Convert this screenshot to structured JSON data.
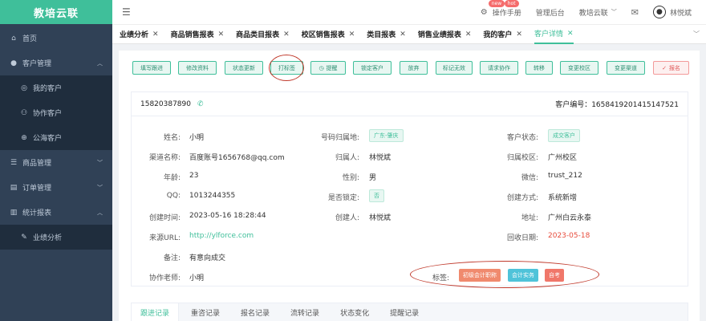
{
  "app": {
    "logo": "教培云联"
  },
  "sidebar": {
    "items": [
      {
        "label": "首页",
        "icon": "home-icon",
        "glyph": "⌂"
      },
      {
        "label": "客户管理",
        "icon": "user-icon",
        "glyph": "👤",
        "expanded": true
      },
      {
        "label": "我的客户",
        "sub": true,
        "glyph": "◎"
      },
      {
        "label": "协作客户",
        "sub": true,
        "glyph": "⚇"
      },
      {
        "label": "公海客户",
        "sub": true,
        "glyph": "⊕"
      },
      {
        "label": "商品管理",
        "icon": "goods-icon",
        "glyph": "☰"
      },
      {
        "label": "订单管理",
        "icon": "order-icon",
        "glyph": "▤"
      },
      {
        "label": "统计报表",
        "icon": "report-icon",
        "glyph": "▥",
        "expanded": true
      },
      {
        "label": "业绩分析",
        "sub": true,
        "glyph": "✎"
      }
    ]
  },
  "topbar": {
    "manual": "操作手册",
    "manual_badge_new": "new",
    "manual_badge_hot": "hot",
    "admin": "管理后台",
    "org": "教培云联",
    "user": "林悦斌"
  },
  "tabs": [
    {
      "label": "业绩分析"
    },
    {
      "label": "商品销售报表"
    },
    {
      "label": "商品类目报表"
    },
    {
      "label": "校区销售报表"
    },
    {
      "label": "类目报表"
    },
    {
      "label": "销售业绩报表"
    },
    {
      "label": "我的客户"
    },
    {
      "label": "客户详情",
      "active": true
    }
  ],
  "actions": [
    "填写跟进",
    "修改资料",
    "状态更新",
    "打标签",
    "提醒",
    "锁定客户",
    "放弃",
    "标记无效",
    "请求协作",
    "转移",
    "变更校区",
    "变更渠道",
    "报名"
  ],
  "customer": {
    "phone": "15820387890",
    "id_label": "客户编号：",
    "id_value": "1658419201415147521",
    "fields": {
      "name_label": "姓名:",
      "name": "小明",
      "channel_label": "渠道名称:",
      "channel": "百度账号1656768@qq.com",
      "age_label": "年龄:",
      "age": "23",
      "qq_label": "QQ:",
      "qq": "1013244355",
      "created_label": "创建时间:",
      "created": "2023-05-16 18:28:44",
      "source_label": "来源URL:",
      "source": "http://ylforce.com",
      "remark_label": "备注:",
      "remark": "有意向成交",
      "teacher_label": "协作老师:",
      "teacher": "小明",
      "phone_loc_label": "号码归属地:",
      "phone_loc": "广东-肇庆",
      "owner_label": "归属人:",
      "owner": "林悦斌",
      "gender_label": "性别:",
      "gender": "男",
      "locked_label": "是否锁定:",
      "locked": "否",
      "creator_label": "创建人:",
      "creator": "林悦斌",
      "status_label": "客户状态:",
      "status": "成交客户",
      "campus_label": "归属校区:",
      "campus": "广州校区",
      "wechat_label": "微信:",
      "wechat": "trust_212",
      "method_label": "创建方式:",
      "method": "系统新增",
      "address_label": "地址:",
      "address": "广州白云永泰",
      "return_label": "回收日期:",
      "return_date": "2023-05-18",
      "tags_label": "标签:"
    },
    "tags": [
      {
        "label": "初级会计职称",
        "color": "#f08a6e"
      },
      {
        "label": "会计实务",
        "color": "#4fc3d9"
      },
      {
        "label": "自考",
        "color": "#f0776a"
      }
    ]
  },
  "bottom_tabs": [
    "跟进记录",
    "重咨记录",
    "报名记录",
    "流转记录",
    "状态变化",
    "提醒记录"
  ],
  "colors": {
    "accent": "#3fbf9a",
    "sidebar": "#304156",
    "danger": "#e05656"
  }
}
